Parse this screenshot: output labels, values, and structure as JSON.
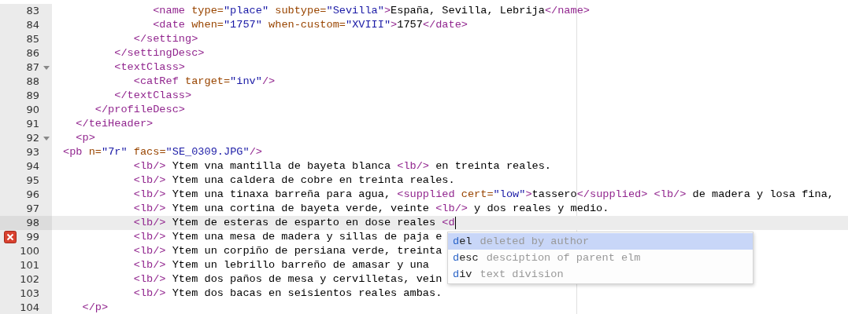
{
  "editor": {
    "lines": [
      {
        "number": "83",
        "foldable": false,
        "error": false,
        "current": false,
        "tokens": [
          {
            "kind": "tag",
            "text": "              <name"
          },
          {
            "kind": "attr",
            "text": " type="
          },
          {
            "kind": "value",
            "text": "\"place\""
          },
          {
            "kind": "attr",
            "text": " subtype="
          },
          {
            "kind": "value",
            "text": "\"Sevilla\""
          },
          {
            "kind": "tag",
            "text": ">"
          },
          {
            "kind": "text",
            "text": "España, Sevilla, Lebrija"
          },
          {
            "kind": "tag",
            "text": "</name>"
          }
        ]
      },
      {
        "number": "84",
        "foldable": false,
        "error": false,
        "current": false,
        "tokens": [
          {
            "kind": "tag",
            "text": "              <date"
          },
          {
            "kind": "attr",
            "text": " when="
          },
          {
            "kind": "value",
            "text": "\"1757\""
          },
          {
            "kind": "attr",
            "text": " when-custom="
          },
          {
            "kind": "value",
            "text": "\"XVIII\""
          },
          {
            "kind": "tag",
            "text": ">"
          },
          {
            "kind": "text",
            "text": "1757"
          },
          {
            "kind": "tag",
            "text": "</date>"
          }
        ]
      },
      {
        "number": "85",
        "foldable": false,
        "error": false,
        "current": false,
        "tokens": [
          {
            "kind": "tag",
            "text": "           </setting>"
          }
        ]
      },
      {
        "number": "86",
        "foldable": false,
        "error": false,
        "current": false,
        "tokens": [
          {
            "kind": "tag",
            "text": "        </settingDesc>"
          }
        ]
      },
      {
        "number": "87",
        "foldable": true,
        "error": false,
        "current": false,
        "tokens": [
          {
            "kind": "tag",
            "text": "        <textClass>"
          }
        ]
      },
      {
        "number": "88",
        "foldable": false,
        "error": false,
        "current": false,
        "tokens": [
          {
            "kind": "tag",
            "text": "           <catRef"
          },
          {
            "kind": "attr",
            "text": " target="
          },
          {
            "kind": "value",
            "text": "\"inv\""
          },
          {
            "kind": "tag",
            "text": "/>"
          }
        ]
      },
      {
        "number": "89",
        "foldable": false,
        "error": false,
        "current": false,
        "tokens": [
          {
            "kind": "tag",
            "text": "        </textClass>"
          }
        ]
      },
      {
        "number": "90",
        "foldable": false,
        "error": false,
        "current": false,
        "tokens": [
          {
            "kind": "tag",
            "text": "     </profileDesc>"
          }
        ]
      },
      {
        "number": "91",
        "foldable": false,
        "error": false,
        "current": false,
        "tokens": [
          {
            "kind": "tag",
            "text": "  </teiHeader>"
          }
        ]
      },
      {
        "number": "92",
        "foldable": true,
        "error": false,
        "current": false,
        "tokens": [
          {
            "kind": "tag",
            "text": "  <p>"
          }
        ]
      },
      {
        "number": "93",
        "foldable": false,
        "error": false,
        "current": false,
        "tokens": [
          {
            "kind": "tag",
            "text": "<pb"
          },
          {
            "kind": "attr",
            "text": " n="
          },
          {
            "kind": "value",
            "text": "\"7r\""
          },
          {
            "kind": "attr",
            "text": " facs="
          },
          {
            "kind": "value",
            "text": "\"SE_0309.JPG\""
          },
          {
            "kind": "tag",
            "text": "/>"
          }
        ]
      },
      {
        "number": "94",
        "foldable": false,
        "error": false,
        "current": false,
        "tokens": [
          {
            "kind": "tag",
            "text": "           <lb/>"
          },
          {
            "kind": "text",
            "text": " Ytem vna mantilla de bayeta blanca "
          },
          {
            "kind": "tag",
            "text": "<lb/>"
          },
          {
            "kind": "text",
            "text": " en treinta reales."
          }
        ]
      },
      {
        "number": "95",
        "foldable": false,
        "error": false,
        "current": false,
        "tokens": [
          {
            "kind": "tag",
            "text": "           <lb/>"
          },
          {
            "kind": "text",
            "text": " Ytem una caldera de cobre en treinta reales."
          }
        ]
      },
      {
        "number": "96",
        "foldable": false,
        "error": false,
        "current": false,
        "tokens": [
          {
            "kind": "tag",
            "text": "           <lb/>"
          },
          {
            "kind": "text",
            "text": " Ytem una tinaxa barreña para agua, "
          },
          {
            "kind": "tag",
            "text": "<supplied"
          },
          {
            "kind": "attr",
            "text": " cert="
          },
          {
            "kind": "value",
            "text": "\"low\""
          },
          {
            "kind": "tag",
            "text": ">"
          },
          {
            "kind": "text",
            "text": "tassero"
          },
          {
            "kind": "tag",
            "text": "</supplied>"
          },
          {
            "kind": "tag",
            "text": " <lb/>"
          },
          {
            "kind": "text",
            "text": " de madera y losa fina,"
          }
        ]
      },
      {
        "number": "97",
        "foldable": false,
        "error": false,
        "current": false,
        "tokens": [
          {
            "kind": "tag",
            "text": "           <lb/>"
          },
          {
            "kind": "text",
            "text": " Ytem una cortina de bayeta verde, veinte "
          },
          {
            "kind": "tag",
            "text": "<lb/>"
          },
          {
            "kind": "text",
            "text": " y dos reales y medio."
          }
        ]
      },
      {
        "number": "98",
        "foldable": false,
        "error": false,
        "current": true,
        "tokens": [
          {
            "kind": "tag",
            "text": "           <lb/>"
          },
          {
            "kind": "text",
            "text": " Ytem de esteras de esparto en dose reales "
          },
          {
            "kind": "tag",
            "text": "<d"
          }
        ]
      },
      {
        "number": "99",
        "foldable": false,
        "error": true,
        "current": false,
        "tokens": [
          {
            "kind": "tag",
            "text": "           <lb/>"
          },
          {
            "kind": "text",
            "text": " Ytem una mesa de madera y sillas de paja e"
          }
        ]
      },
      {
        "number": "100",
        "foldable": false,
        "error": false,
        "current": false,
        "tokens": [
          {
            "kind": "tag",
            "text": "           <lb/>"
          },
          {
            "kind": "text",
            "text": " Ytem un corpiño de persiana verde, treinta"
          }
        ]
      },
      {
        "number": "101",
        "foldable": false,
        "error": false,
        "current": false,
        "tokens": [
          {
            "kind": "tag",
            "text": "           <lb/>"
          },
          {
            "kind": "text",
            "text": " Ytem un lebrillo barreño de amasar y una"
          }
        ]
      },
      {
        "number": "102",
        "foldable": false,
        "error": false,
        "current": false,
        "tokens": [
          {
            "kind": "tag",
            "text": "           <lb/>"
          },
          {
            "kind": "text",
            "text": " Ytem dos paños de mesa y cervilletas, vein"
          }
        ]
      },
      {
        "number": "103",
        "foldable": false,
        "error": false,
        "current": false,
        "tokens": [
          {
            "kind": "tag",
            "text": "           <lb/>"
          },
          {
            "kind": "text",
            "text": " Ytem dos bacas en seisientos reales ambas."
          }
        ]
      },
      {
        "number": "104",
        "foldable": false,
        "error": false,
        "current": false,
        "tokens": [
          {
            "kind": "tag",
            "text": "   </p>"
          }
        ]
      }
    ],
    "autocomplete": [
      {
        "match": "d",
        "rest": "el",
        "description": "deleted by author",
        "selected": true
      },
      {
        "match": "d",
        "rest": "esc",
        "description": "desciption of parent elm",
        "selected": false
      },
      {
        "match": "d",
        "rest": "iv",
        "description": "text division",
        "selected": false
      }
    ]
  }
}
